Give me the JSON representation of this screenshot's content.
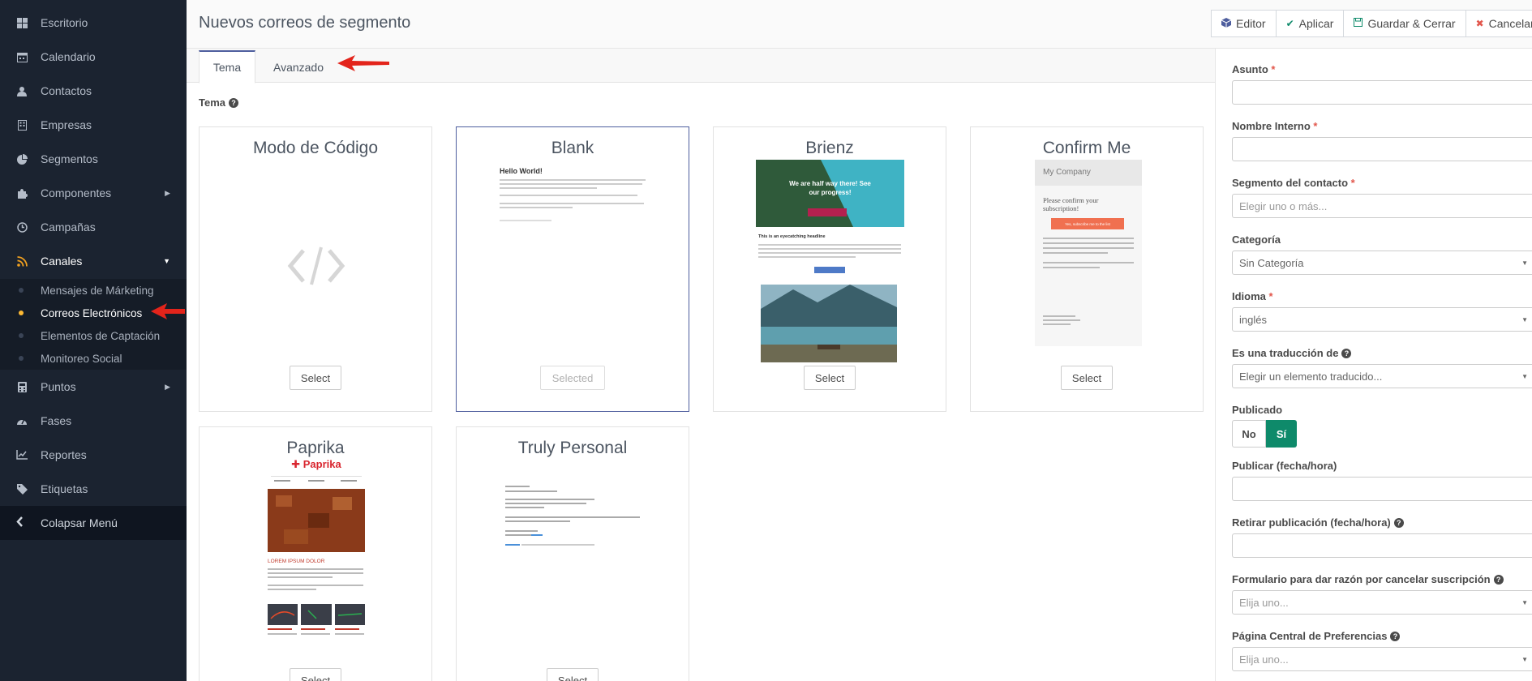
{
  "sidebar": {
    "items": [
      {
        "label": "Escritorio",
        "icon": "dashboard-icon"
      },
      {
        "label": "Calendario",
        "icon": "calendar-icon"
      },
      {
        "label": "Contactos",
        "icon": "user-icon"
      },
      {
        "label": "Empresas",
        "icon": "building-icon"
      },
      {
        "label": "Segmentos",
        "icon": "pie-chart-icon"
      },
      {
        "label": "Componentes",
        "icon": "puzzle-icon"
      },
      {
        "label": "Campañas",
        "icon": "clock-icon"
      },
      {
        "label": "Canales",
        "icon": "rss-icon"
      },
      {
        "label": "Puntos",
        "icon": "calculator-icon"
      },
      {
        "label": "Fases",
        "icon": "tachometer-icon"
      },
      {
        "label": "Reportes",
        "icon": "line-chart-icon"
      },
      {
        "label": "Etiquetas",
        "icon": "tag-icon"
      }
    ],
    "submenu": [
      {
        "label": "Mensajes de Márketing"
      },
      {
        "label": "Correos Electrónicos"
      },
      {
        "label": "Elementos de Captación"
      },
      {
        "label": "Monitoreo Social"
      }
    ],
    "collapse_label": "Colapsar Menú"
  },
  "header": {
    "title": "Nuevos correos de segmento",
    "buttons": {
      "editor": "Editor",
      "apply": "Aplicar",
      "save_close": "Guardar & Cerrar",
      "cancel": "Cancelar"
    }
  },
  "tabs": {
    "theme": "Tema",
    "advanced": "Avanzado"
  },
  "theme_section": {
    "label": "Tema",
    "select_label": "Select",
    "selected_label": "Selected",
    "cards": [
      {
        "title": "Modo de Código"
      },
      {
        "title": "Blank"
      },
      {
        "title": "Brienz"
      },
      {
        "title": "Confirm Me"
      },
      {
        "title": "Paprika"
      },
      {
        "title": "Truly Personal"
      }
    ],
    "previews": {
      "blank_heading": "Hello World!",
      "brienz_hero": "We are half way there! See our progress!",
      "brienz_head": "This is an eyecatching headline",
      "confirm_company": "My Company",
      "confirm_text": "Please confirm your subscription!",
      "confirm_btn": "Yes, subscribe me to the list",
      "paprika_logo": "Paprika",
      "paprika_heading": "LOREM IPSUM DOLOR"
    }
  },
  "form": {
    "subject": {
      "label": "Asunto",
      "required": "*",
      "value": ""
    },
    "internal_name": {
      "label": "Nombre Interno",
      "required": "*",
      "value": ""
    },
    "segment": {
      "label": "Segmento del contacto",
      "required": "*",
      "placeholder": "Elegir uno o más..."
    },
    "category": {
      "label": "Categoría",
      "value": "Sin Categoría"
    },
    "language": {
      "label": "Idioma",
      "required": "*",
      "value": "inglés"
    },
    "translation": {
      "label": "Es una traducción de",
      "value": "Elegir un elemento traducido..."
    },
    "published": {
      "label": "Publicado",
      "no": "No",
      "yes": "Sí"
    },
    "publish_up": {
      "label": "Publicar (fecha/hora)"
    },
    "publish_down": {
      "label": "Retirar publicación (fecha/hora)"
    },
    "unsubscribe_form": {
      "label": "Formulario para dar razón por cancelar suscripción",
      "value": "Elija uno..."
    },
    "preference_center": {
      "label": "Página Central de Preferencias",
      "value": "Elija uno..."
    }
  },
  "colors": {
    "sidebar_bg": "#1b2330",
    "accent": "#4e5e9e",
    "published_yes": "#0e8a6a",
    "required": "#e2574c",
    "annotation_arrow": "#e3241b"
  }
}
